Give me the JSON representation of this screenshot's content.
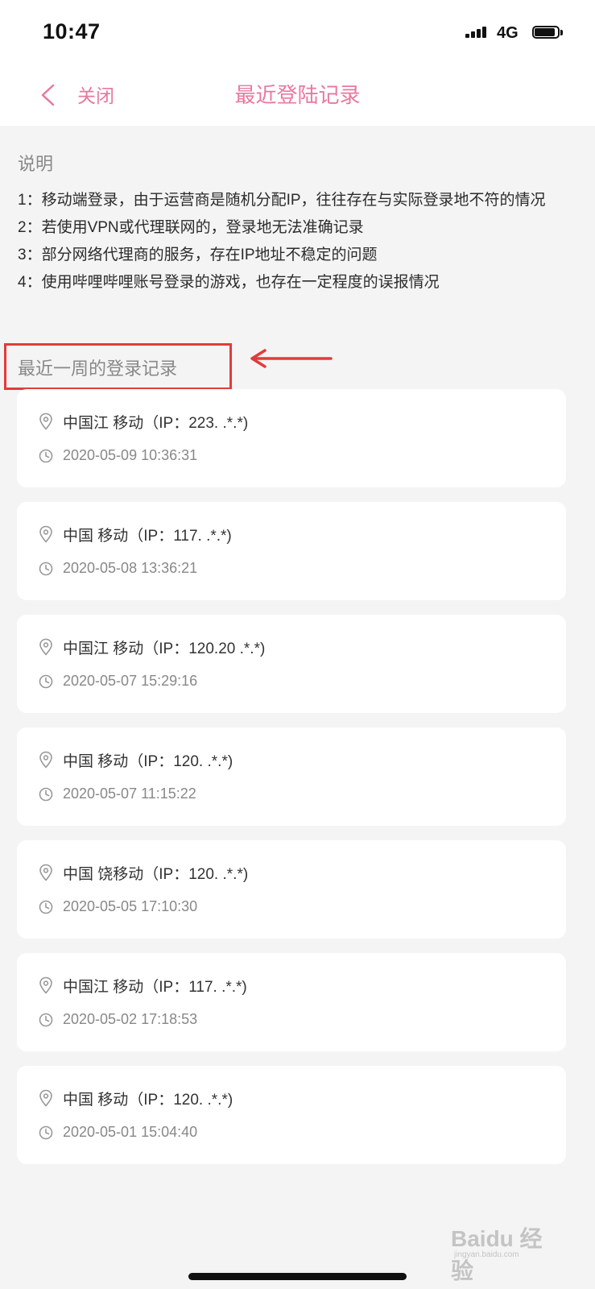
{
  "status_bar": {
    "time": "10:47",
    "network": "4G",
    "battery_level": 0.9
  },
  "nav": {
    "back_icon": "chevron-left-icon",
    "close_label": "关闭",
    "title": "最近登陆记录",
    "accent_color": "#e8799d"
  },
  "notes": {
    "heading": "说明",
    "lines": [
      "1：移动端登录，由于运营商是随机分配IP，往往存在与实际登录地不符的情况",
      "2：若使用VPN或代理联网的，登录地无法准确记录",
      "3：部分网络代理商的服务，存在IP地址不稳定的问题",
      "4：使用哔哩哔哩账号登录的游戏，也存在一定程度的误报情况"
    ]
  },
  "section": {
    "label": "最近一周的登录记录",
    "annotation_color": "#e23b3b"
  },
  "records": [
    {
      "location": "中国江 移动（IP：223. .*.*)",
      "time": "2020-05-09 10:36:31"
    },
    {
      "location": "中国 移动（IP：117. .*.*)",
      "time": "2020-05-08 13:36:21"
    },
    {
      "location": "中国江 移动（IP：120.20 .*.*)",
      "time": "2020-05-07 15:29:16"
    },
    {
      "location": "中国 移动（IP：120. .*.*)",
      "time": "2020-05-07 11:15:22"
    },
    {
      "location": "中国 饶移动（IP：120. .*.*)",
      "time": "2020-05-05 17:10:30"
    },
    {
      "location": "中国江 移动（IP：117. .*.*)",
      "time": "2020-05-02 17:18:53"
    },
    {
      "location": "中国 移动（IP：120. .*.*)",
      "time": "2020-05-01 15:04:40"
    }
  ],
  "watermark": {
    "brand": "Baidu 经验",
    "sub": "jingyan.baidu.com"
  }
}
